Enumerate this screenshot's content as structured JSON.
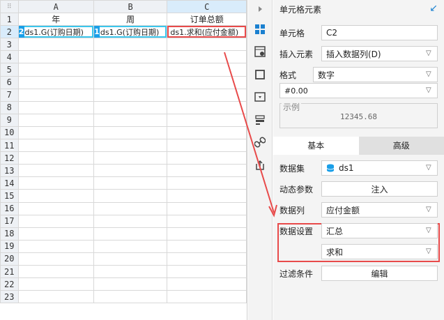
{
  "sheet": {
    "columns": [
      "A",
      "B",
      "C"
    ],
    "selected_column": "C",
    "header_row": [
      "年",
      "周",
      "订单总额"
    ],
    "data_row": [
      "ds1.G(订购日期)",
      "ds1.G(订购日期)",
      "ds1.求和(应付金额)"
    ],
    "badges": [
      "2",
      "1"
    ],
    "rows": [
      "1",
      "2",
      "3",
      "4",
      "5",
      "6",
      "7",
      "8",
      "9",
      "10",
      "11",
      "12",
      "13",
      "14",
      "15",
      "16",
      "17",
      "18",
      "19",
      "20",
      "21",
      "22",
      "23"
    ]
  },
  "panel": {
    "title": "单元格元素",
    "cell_label": "单元格",
    "cell_value": "C2",
    "insert_label": "插入元素",
    "insert_value": "插入数据列(D)",
    "format_label": "格式",
    "format_value": "数字",
    "format_pattern": "#0.00",
    "example_label": "示例",
    "example_value": "12345.68",
    "tab_basic": "基本",
    "tab_advanced": "高级",
    "dataset_label": "数据集",
    "dataset_value": "ds1",
    "dynamic_label": "动态参数",
    "dynamic_button": "注入",
    "column_label": "数据列",
    "column_value": "应付金额",
    "setting_label": "数据设置",
    "setting_value": "汇总",
    "setting_sub_value": "求和",
    "filter_label": "过滤条件",
    "filter_button": "编辑"
  },
  "icons": {
    "expand": "chevron-right-icon",
    "cell_element": "grid-icon",
    "cell_attr": "cell-attribute-icon",
    "widget": "square-icon",
    "condition": "dropdown-box-icon",
    "hyperlink_list": "list-icon",
    "link": "link-icon",
    "export": "export-icon"
  },
  "colors": {
    "accent": "#1a9fe8",
    "highlight_cyan": "#3cc6ec",
    "highlight_red": "#e84a4a",
    "selected_header": "#d9ecfb"
  }
}
